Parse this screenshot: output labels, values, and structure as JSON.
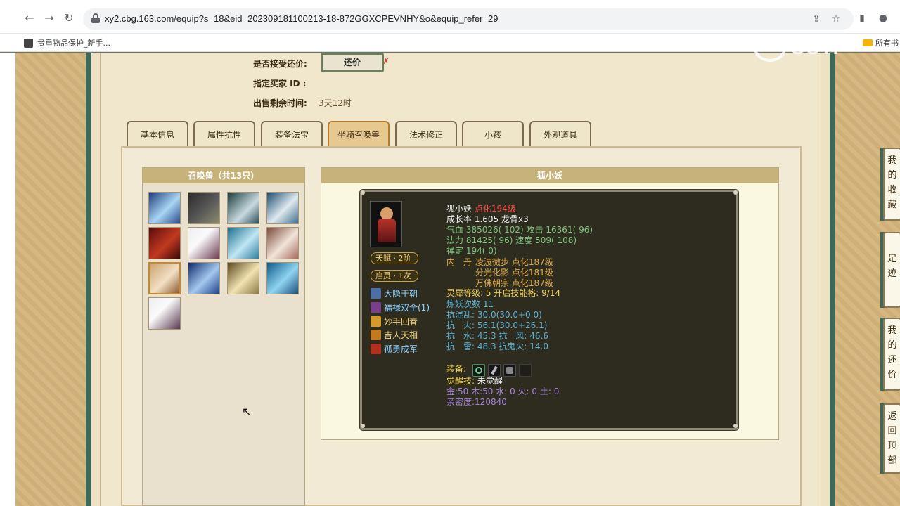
{
  "browser": {
    "url": "xy2.cbg.163.com/equip?s=18&eid=202309181100213-18-872GGXCPEVNHY&o&equip_refer=29",
    "bookmark": "贵重物品保护_新手...",
    "bookmark_right": "所有书"
  },
  "watermark": "CCTI",
  "sale_info": {
    "haggle_label": "是否接受还价:",
    "haggle_button": "还价",
    "buyer_label": "指定买家 ID :",
    "time_label": "出售剩余时间:",
    "time_value": "3天12时"
  },
  "tabs": [
    "基本信息",
    "属性抗性",
    "装备法宝",
    "坐骑召唤兽",
    "法术修正",
    "小孩",
    "外观道具"
  ],
  "active_tab": 3,
  "pet_list": {
    "title": "召唤兽（共13只）",
    "count": 13,
    "selected": 8
  },
  "pet": {
    "name_header": "狐小妖",
    "name": "狐小妖",
    "level": "点化194级",
    "growth_line": "成长率 1.605 龙骨x3",
    "hp_label": "气血",
    "hp": "385026( 102)",
    "atk_label": "攻击",
    "atk": "16361( 96)",
    "mp_label": "法力",
    "mp": "81425( 96)",
    "spd_label": "速度",
    "spd": "509( 108)",
    "def_label": "禅定",
    "def": "194( 0)",
    "neidan_label": "内　丹",
    "neidan": [
      "凌波微步 点化187级",
      "分光化影 点化181级",
      "万佛朝宗 点化187级"
    ],
    "spirit_line": "灵犀等级:  5  开启技能格:  9/14",
    "refine_line": "炼妖次数 11",
    "res1": "抗混乱: 30.0(30.0+0.0)",
    "res2": "抗　火: 56.1(30.0+26.1)",
    "res3": "抗　水: 45.3 抗　风: 46.6",
    "res4": "抗　雷: 48.3 抗鬼火: 14.0",
    "equip_label": "装备:",
    "awaken_label": "觉醒技:",
    "awaken_value": "未觉醒",
    "elements": "金:50 木:50 水: 0 火: 0 土: 0",
    "intimacy": "亲密度:120840",
    "talent": "天赋 · 2阶",
    "qiling": "启灵 · 1次",
    "skills": [
      "大隐于朝",
      "福禄双全(1)",
      "妙手回春",
      "吉人天相",
      "孤勇成军"
    ]
  },
  "side_nav": [
    "我的收藏",
    "足迹",
    "我的还价",
    "返回顶部"
  ]
}
